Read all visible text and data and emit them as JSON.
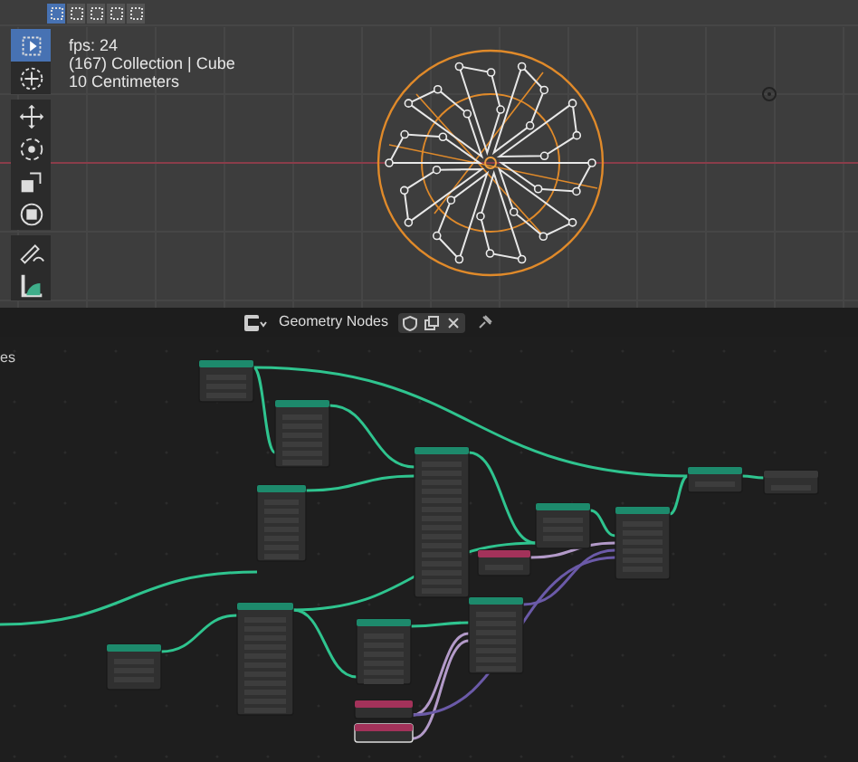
{
  "viewport": {
    "select_modes": [
      {
        "selected": true
      },
      {
        "selected": false
      },
      {
        "selected": false
      },
      {
        "selected": false
      },
      {
        "selected": false
      }
    ],
    "tools": [
      {
        "selected": true
      },
      {
        "selected": false
      },
      {
        "selected": false
      },
      {
        "selected": false
      },
      {
        "selected": false
      },
      {
        "selected": false
      },
      {
        "selected": false
      },
      {
        "selected": false
      }
    ],
    "overlay_lines": [
      "fps: 24",
      "(167) Collection | Cube",
      "10 Centimeters"
    ]
  },
  "node_editor": {
    "title": "Geometry Nodes",
    "side_label": "es",
    "nodes": [
      {
        "color": "#1d8a6c"
      },
      {
        "color": "#1d8a6c"
      },
      {
        "color": "#1d8a6c"
      },
      {
        "color": "#1d8a6c"
      },
      {
        "color": "#1d8a6c"
      },
      {
        "color": "#1d8a6c"
      },
      {
        "color": "#1d8a6c"
      },
      {
        "color": "#3a3a3a"
      },
      {
        "color": "#a3325a"
      },
      {
        "color": "#1d8a6c"
      },
      {
        "color": "#1d8a6c"
      },
      {
        "color": "#1d8a6c"
      },
      {
        "color": "#1d8a6c"
      },
      {
        "color": "#a3325a"
      },
      {
        "color": "#a3325a"
      }
    ]
  }
}
